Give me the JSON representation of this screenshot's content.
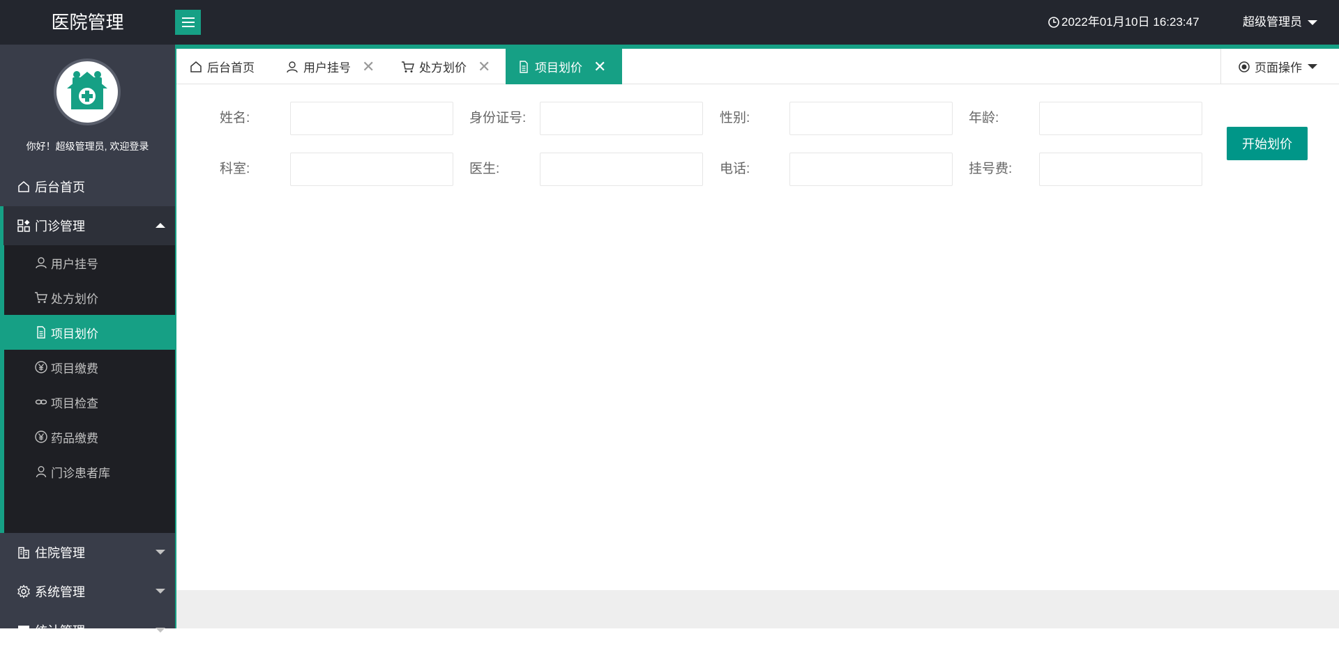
{
  "header": {
    "app_title": "医院管理",
    "datetime": "2022年01月10日 16:23:47",
    "user": "超级管理员"
  },
  "sidebar": {
    "welcome": "你好！超级管理员, 欢迎登录",
    "items": [
      {
        "label": "后台首页",
        "icon": "home-icon"
      },
      {
        "label": "门诊管理",
        "icon": "grid-icon",
        "expanded": true
      },
      {
        "label": "住院管理",
        "icon": "building-icon"
      },
      {
        "label": "系统管理",
        "icon": "gear-icon"
      },
      {
        "label": "统计管理",
        "icon": "monitor-icon"
      }
    ],
    "submenu": [
      {
        "label": "用户挂号",
        "icon": "user-icon"
      },
      {
        "label": "处方划价",
        "icon": "cart-icon"
      },
      {
        "label": "项目划价",
        "icon": "document-icon",
        "active": true
      },
      {
        "label": "项目缴费",
        "icon": "yen-icon"
      },
      {
        "label": "项目检查",
        "icon": "link-icon"
      },
      {
        "label": "药品缴费",
        "icon": "yen-icon"
      },
      {
        "label": "门诊患者库",
        "icon": "person-icon"
      }
    ]
  },
  "tabs": [
    {
      "label": "后台首页",
      "icon": "home-icon",
      "closable": false
    },
    {
      "label": "用户挂号",
      "icon": "user-icon",
      "closable": true
    },
    {
      "label": "处方划价",
      "icon": "cart-icon",
      "closable": true
    },
    {
      "label": "项目划价",
      "icon": "document-icon",
      "closable": true,
      "active": true
    }
  ],
  "tab_close_symbol": "✕",
  "page_ops": "页面操作",
  "form": {
    "name_label": "姓名:",
    "idcard_label": "身份证号:",
    "gender_label": "性别:",
    "age_label": "年龄:",
    "dept_label": "科室:",
    "doctor_label": "医生:",
    "phone_label": "电话:",
    "fee_label": "挂号费:",
    "name_value": "",
    "idcard_value": "",
    "gender_value": "",
    "age_value": "",
    "dept_value": "",
    "doctor_value": "",
    "phone_value": "",
    "fee_value": ""
  },
  "actions": {
    "start_label": "开始划价"
  },
  "colors": {
    "accent": "#16a085",
    "button": "#009688",
    "header_bg": "#23262e",
    "sidebar_bg": "#393d49",
    "submenu_bg": "#1e1f24"
  }
}
